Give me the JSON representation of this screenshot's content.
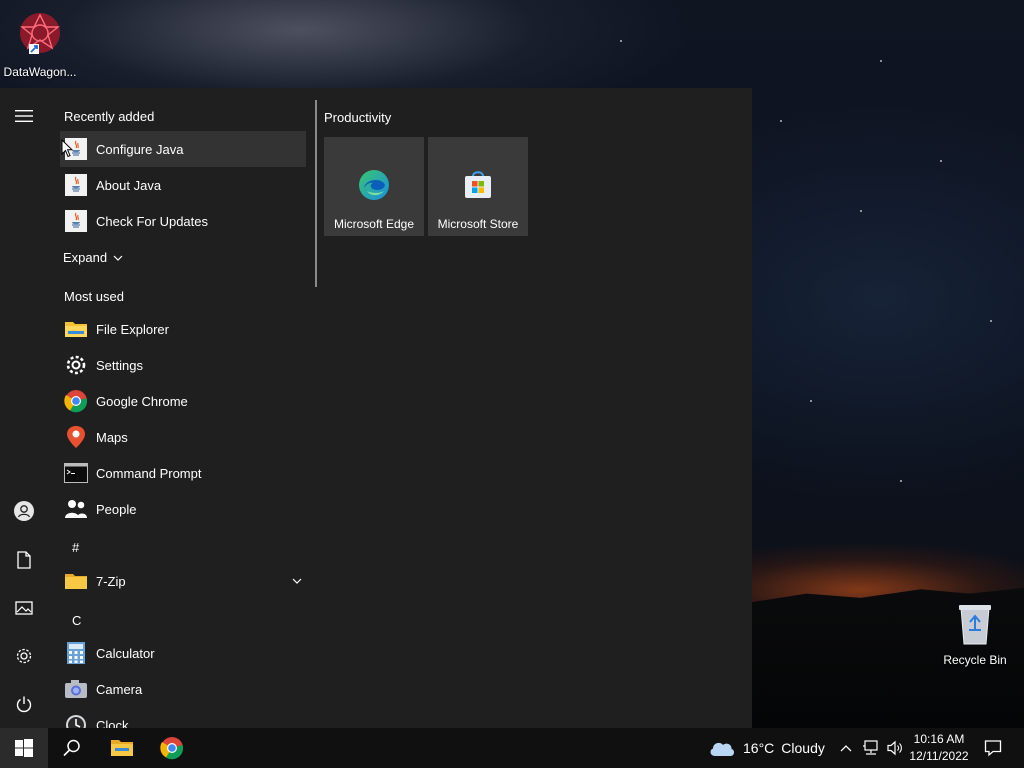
{
  "desktop": {
    "icons": [
      {
        "label": "DataWagon...",
        "icon": "datawagon-icon"
      },
      {
        "label": "Recycle Bin",
        "icon": "recycle-bin-icon"
      }
    ]
  },
  "start_menu": {
    "recently_added": {
      "heading": "Recently added",
      "items": [
        {
          "label": "Configure Java",
          "icon": "java-icon"
        },
        {
          "label": "About Java",
          "icon": "java-icon"
        },
        {
          "label": "Check For Updates",
          "icon": "java-icon"
        }
      ],
      "expand_label": "Expand"
    },
    "most_used": {
      "heading": "Most used",
      "items": [
        {
          "label": "File Explorer",
          "icon": "folder-icon"
        },
        {
          "label": "Settings",
          "icon": "gear-icon"
        },
        {
          "label": "Google Chrome",
          "icon": "chrome-icon"
        },
        {
          "label": "Maps",
          "icon": "maps-pin-icon"
        },
        {
          "label": "Command Prompt",
          "icon": "terminal-icon"
        },
        {
          "label": "People",
          "icon": "people-icon"
        }
      ]
    },
    "alpha": [
      {
        "letter": "#",
        "items": [
          {
            "label": "7-Zip",
            "icon": "folder-icon"
          }
        ]
      },
      {
        "letter": "C",
        "items": [
          {
            "label": "Calculator",
            "icon": "calculator-icon"
          },
          {
            "label": "Camera",
            "icon": "camera-icon"
          },
          {
            "label": "Clock",
            "icon": "clock-icon"
          }
        ]
      }
    ],
    "tiles": {
      "group_heading": "Productivity",
      "items": [
        {
          "label": "Microsoft Edge",
          "icon": "edge-icon"
        },
        {
          "label": "Microsoft Store",
          "icon": "store-icon"
        }
      ]
    }
  },
  "taskbar": {
    "weather": {
      "temp": "16°C",
      "condition": "Cloudy"
    },
    "clock": {
      "time": "10:16 AM",
      "date": "12/11/2022"
    }
  },
  "colors": {
    "menu_bg": "#1f1f1f",
    "taskbar_bg": "#101010",
    "tile_bg": "#3a3a3a",
    "hover_bg": "#333333"
  }
}
